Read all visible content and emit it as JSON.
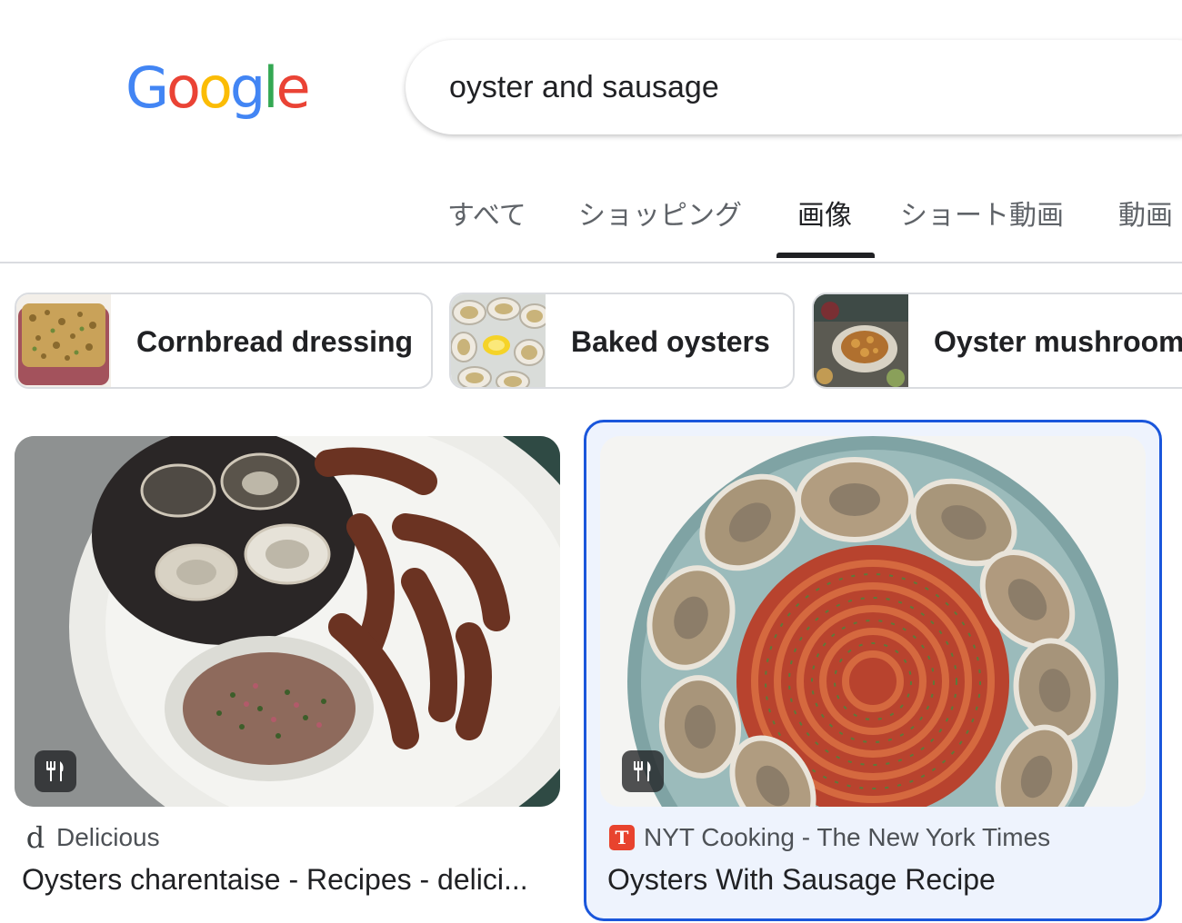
{
  "header": {
    "logo_text": "Google",
    "logo_colors": [
      "#4285F4",
      "#EA4335",
      "#FBBC05",
      "#4285F4",
      "#34A853",
      "#EA4335"
    ]
  },
  "search": {
    "query": "oyster and sausage"
  },
  "tabs": [
    {
      "label": "すべて",
      "active": false
    },
    {
      "label": "ショッピング",
      "active": false
    },
    {
      "label": "画像",
      "active": true
    },
    {
      "label": "ショート動画",
      "active": false
    },
    {
      "label": "動画",
      "active": false
    }
  ],
  "chips": [
    {
      "label": "Cornbread dressing",
      "thumb": "cornbread-dressing-thumbnail"
    },
    {
      "label": "Baked oysters",
      "thumb": "baked-oysters-thumbnail"
    },
    {
      "label": "Oyster mushroom",
      "thumb": "oyster-mushroom-thumbnail"
    }
  ],
  "results": [
    {
      "source": "Delicious",
      "favicon": "d",
      "title": "Oysters charentaise - Recipes - delici...",
      "badge_icon": "fork-knife-icon",
      "selected": false
    },
    {
      "source": "NYT Cooking - The New York Times",
      "favicon": "T",
      "title": "Oysters With Sausage Recipe",
      "badge_icon": "fork-knife-icon",
      "selected": true
    }
  ],
  "colors": {
    "selection_border": "#1a56db",
    "selection_fill": "#eef3fd",
    "nyt_favicon": "#e8432e",
    "active_tab": "#202124",
    "inactive_tab": "#5f6368"
  }
}
